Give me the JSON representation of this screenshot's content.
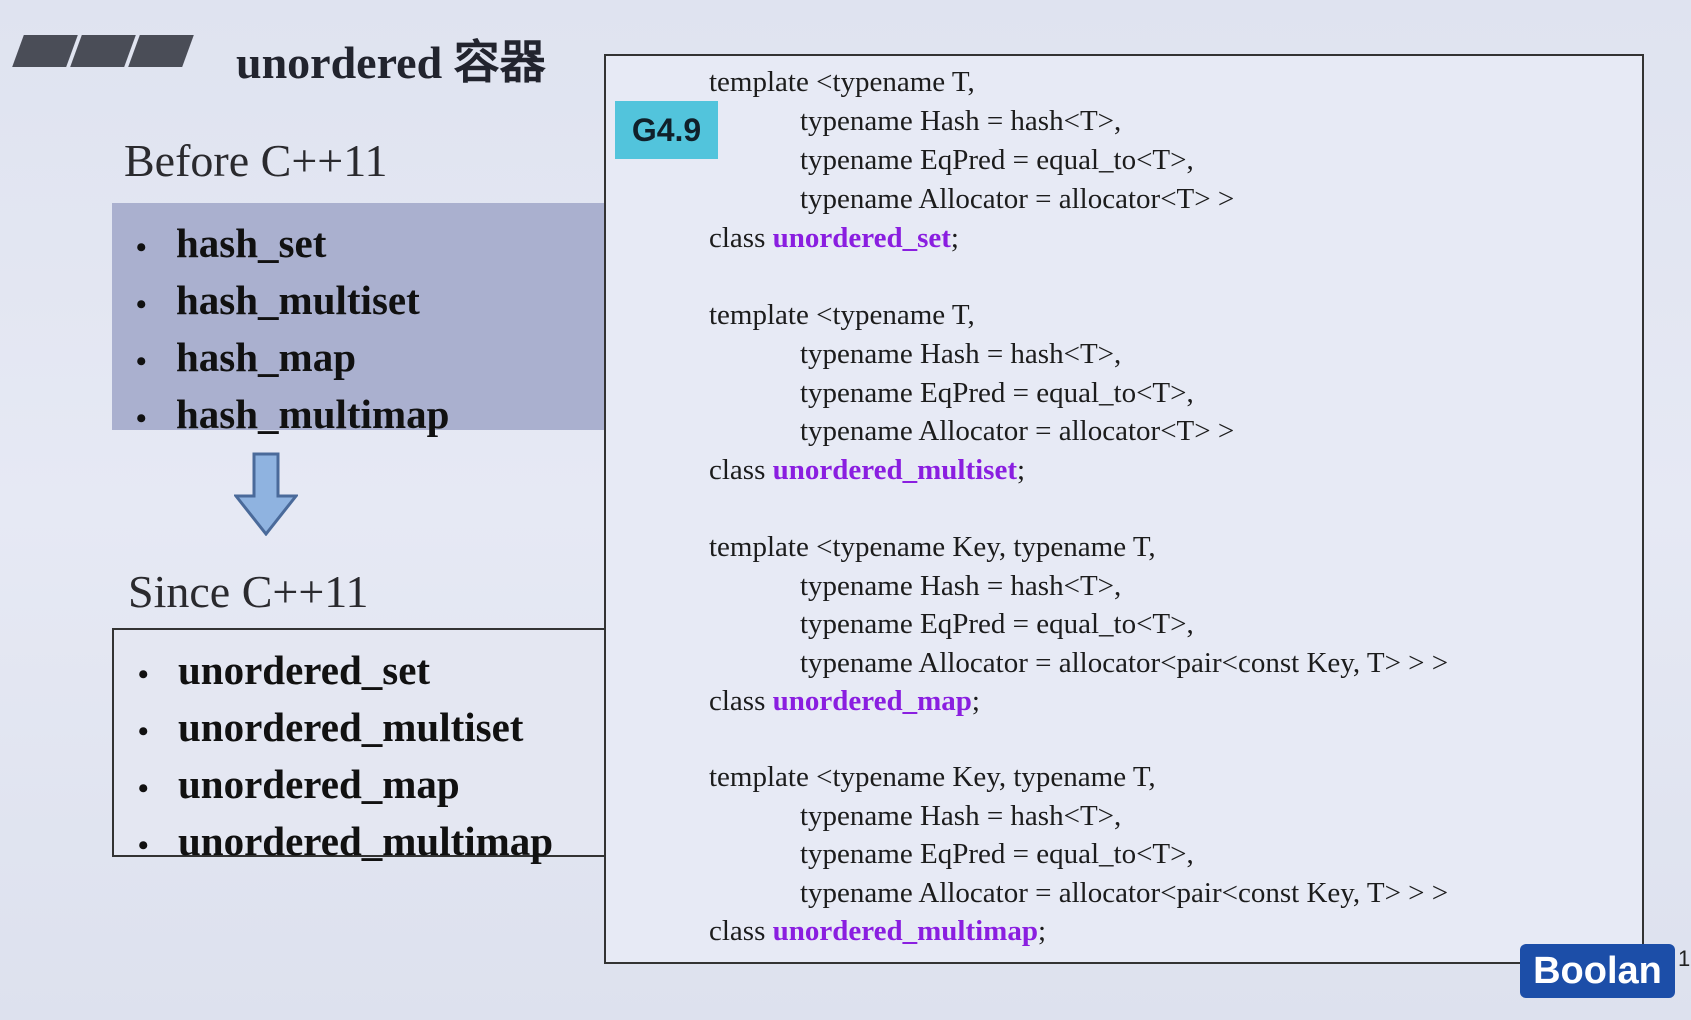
{
  "title": "unordered 容器",
  "before": {
    "heading": "Before C++11",
    "items": [
      "hash_set",
      "hash_multiset",
      "hash_map",
      "hash_multimap"
    ]
  },
  "since": {
    "heading": "Since C++11",
    "items": [
      "unordered_set",
      "unordered_multiset",
      "unordered_map",
      "unordered_multimap"
    ]
  },
  "badge": "G4.9",
  "bullet": "•",
  "code": [
    {
      "lines": [
        "template <typename T,",
        "typename Hash = hash<T>,",
        "typename EqPred = equal_to<T>,",
        "typename Allocator = allocator<T> >"
      ],
      "class_keyword": "class",
      "class_name": "unordered_set",
      "terminator": ";"
    },
    {
      "lines": [
        "template <typename T,",
        "typename Hash = hash<T>,",
        "typename EqPred = equal_to<T>,",
        "typename Allocator = allocator<T> >"
      ],
      "class_keyword": "class",
      "class_name": "unordered_multiset",
      "terminator": ";"
    },
    {
      "lines": [
        "template <typename Key, typename T,",
        "typename Hash = hash<T>,",
        "typename EqPred = equal_to<T>,",
        "typename Allocator = allocator<pair<const Key, T> > >"
      ],
      "class_keyword": "class",
      "class_name": "unordered_map",
      "terminator": ";"
    },
    {
      "lines": [
        "template <typename Key, typename T,",
        "typename Hash = hash<T>,",
        "typename EqPred = equal_to<T>,",
        "typename Allocator = allocator<pair<const Key, T> > >"
      ],
      "class_keyword": "class",
      "class_name": "unordered_multimap",
      "terminator": ";"
    }
  ],
  "logo": "Boolan",
  "page_number": "1",
  "colors": {
    "keyword": "#8a1ee0",
    "badge": "#52c4dc",
    "logo": "#1c4ea8",
    "before_box": "#aab0cf",
    "arrow": "#8fb3e0"
  },
  "icons": {
    "arrow": "down-arrow-icon"
  }
}
